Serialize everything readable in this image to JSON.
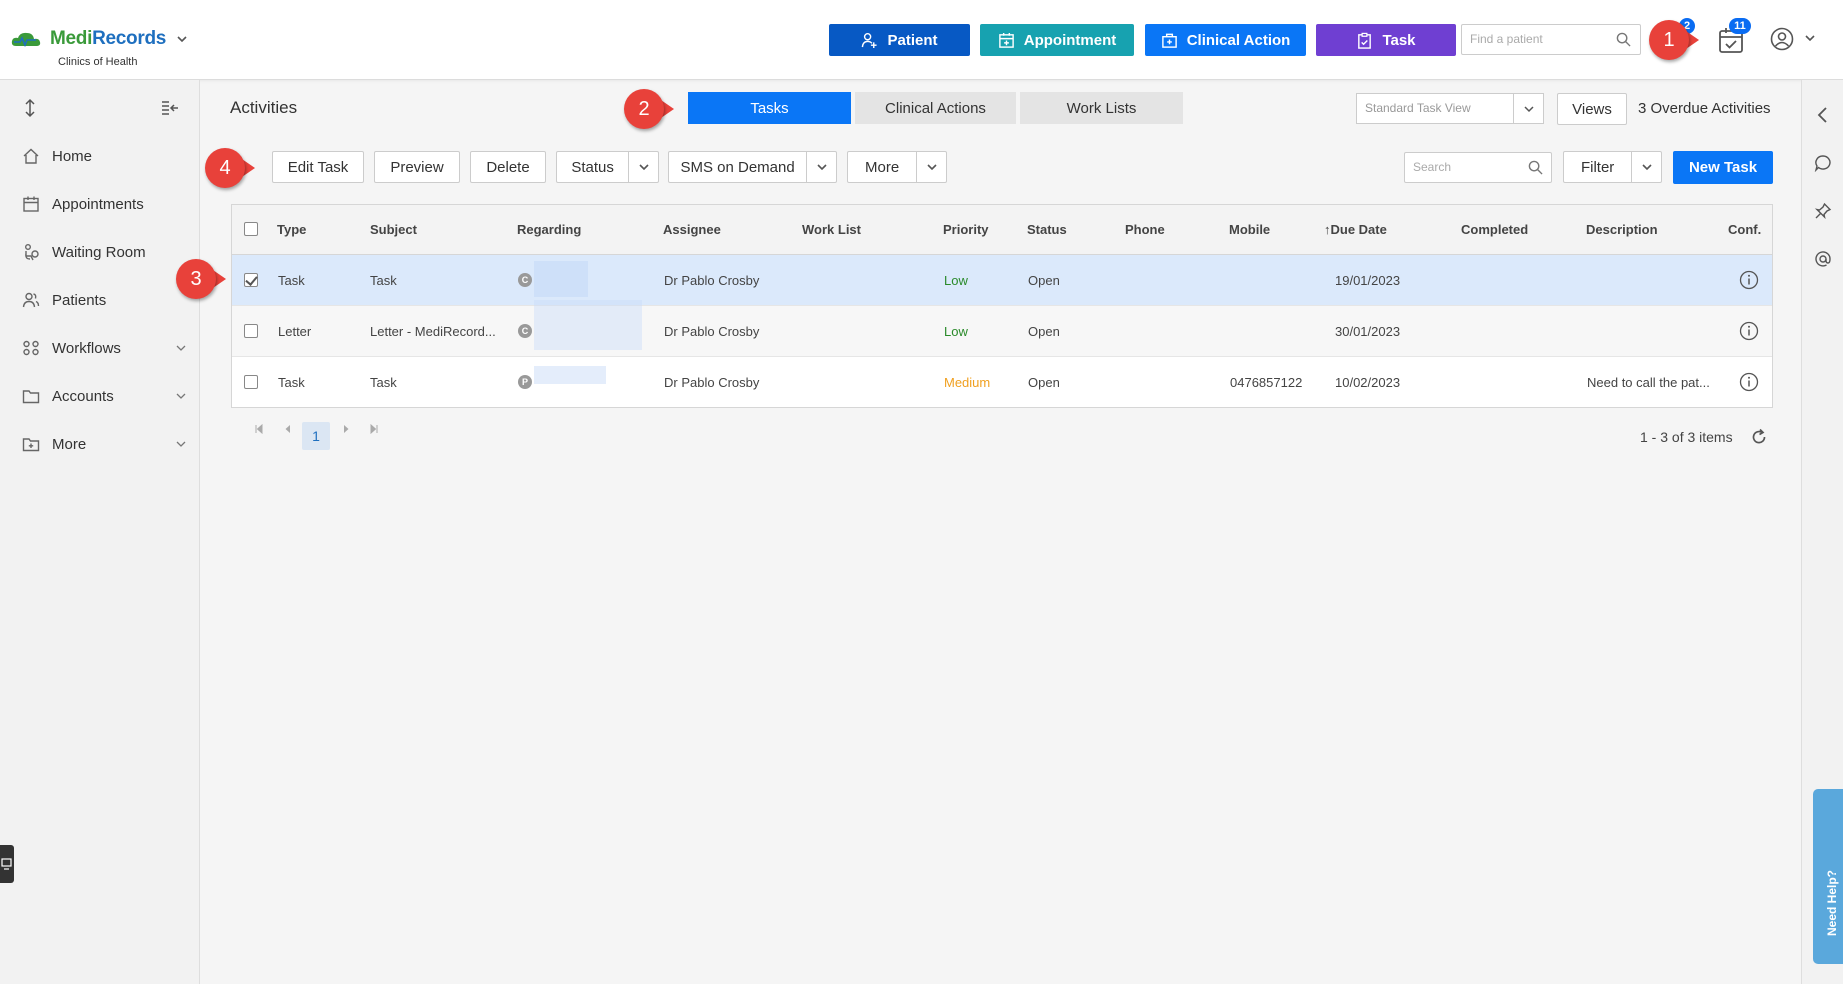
{
  "header": {
    "brand_medi": "Medi",
    "brand_records": "Records",
    "clinic": "Clinics of Health",
    "buttons": [
      {
        "label": "Patient",
        "color": "#0759c4"
      },
      {
        "label": "Appointment",
        "color": "#17a2b0"
      },
      {
        "label": "Clinical Action",
        "color": "#0a76f6"
      },
      {
        "label": "Task",
        "color": "#6f3fd2"
      }
    ],
    "find_placeholder": "Find a patient",
    "badge_small": "2",
    "badge_tasks": "11"
  },
  "sidebar": {
    "items": [
      {
        "label": "Home",
        "icon": "home-icon"
      },
      {
        "label": "Appointments",
        "icon": "calendar-icon"
      },
      {
        "label": "Waiting Room",
        "icon": "waiting-room-icon"
      },
      {
        "label": "Patients",
        "icon": "patients-icon"
      },
      {
        "label": "Workflows",
        "icon": "workflows-icon"
      },
      {
        "label": "Accounts",
        "icon": "folder-icon"
      },
      {
        "label": "More",
        "icon": "folder-plus-icon"
      }
    ]
  },
  "main": {
    "title": "Activities",
    "tabs": [
      "Tasks",
      "Clinical Actions",
      "Work Lists"
    ],
    "active_tab": "Tasks",
    "view_select": "Standard Task View",
    "views_label": "Views",
    "overdue": "3 Overdue Activities",
    "toolbar": {
      "edit": "Edit Task",
      "preview": "Preview",
      "delete": "Delete",
      "status": "Status",
      "sms": "SMS on Demand",
      "more": "More",
      "search_placeholder": "Search",
      "filter": "Filter",
      "new_task": "New Task"
    },
    "columns": [
      "Type",
      "Subject",
      "Regarding",
      "Assignee",
      "Work List",
      "Priority",
      "Status",
      "Phone",
      "Mobile",
      "Due Date",
      "Completed",
      "Description",
      "Conf."
    ],
    "sort_arrow": "↑",
    "rows": [
      {
        "type": "Task",
        "subject": "Task",
        "regarding_initial": "C",
        "assignee": "Dr Pablo Crosby",
        "worklist": "",
        "priority": "Low",
        "status": "Open",
        "phone": "",
        "mobile": "",
        "due": "19/01/2023",
        "completed": "",
        "description": "",
        "checked": true
      },
      {
        "type": "Letter",
        "subject": "Letter - MediRecord...",
        "regarding_initial": "C",
        "assignee": "Dr Pablo Crosby",
        "worklist": "",
        "priority": "Low",
        "status": "Open",
        "phone": "",
        "mobile": "",
        "due": "30/01/2023",
        "completed": "",
        "description": "",
        "checked": false
      },
      {
        "type": "Task",
        "subject": "Task",
        "regarding_initial": "P",
        "assignee": "Dr Pablo Crosby",
        "worklist": "",
        "priority": "Medium",
        "status": "Open",
        "phone": "",
        "mobile": "0476857122",
        "due": "10/02/2023",
        "completed": "",
        "description": "Need to call the pat...",
        "checked": false
      }
    ],
    "pager": {
      "current": "1",
      "summary": "1 - 3 of 3 items"
    }
  },
  "help": "Need Help?",
  "callouts": [
    "1",
    "2",
    "3",
    "4"
  ]
}
